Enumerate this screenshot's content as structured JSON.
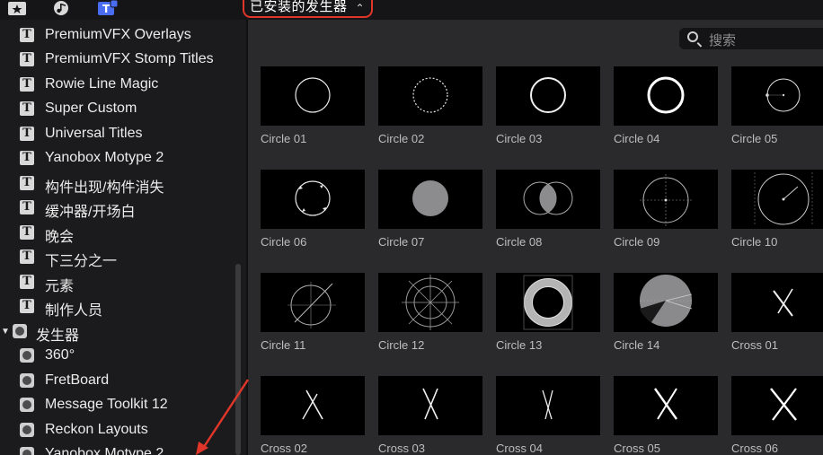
{
  "toolbar": {
    "icons": [
      "clapperboard-star-icon",
      "music-photo-icon",
      "titles-generators-icon"
    ],
    "dropdown_label": "已安装的发生器",
    "dropdown_chevron": "⌃⌄"
  },
  "search": {
    "placeholder": "搜索"
  },
  "sidebar": {
    "title_items": [
      "PremiumVFX Overlays",
      "PremiumVFX Stomp Titles",
      "Rowie Line Magic",
      "Super Custom",
      "Universal Titles",
      "Yanobox Motype 2",
      "构件出现/构件消失",
      "缓冲器/开场白",
      "晚会",
      "下三分之一",
      "元素",
      "制作人员"
    ],
    "group_label": "发生器",
    "generator_items": [
      "360°",
      "FretBoard",
      "Message Toolkit 12",
      "Reckon Layouts",
      "Yanobox Motype 2"
    ]
  },
  "grid": {
    "tiles": [
      "Circle 01",
      "Circle 02",
      "Circle 03",
      "Circle 04",
      "Circle 05",
      "Circle 06",
      "Circle 07",
      "Circle 08",
      "Circle 09",
      "Circle 10",
      "Circle 11",
      "Circle 12",
      "Circle 13",
      "Circle 14",
      "Cross 01",
      "Cross 02",
      "Cross 03",
      "Cross 04",
      "Cross 05",
      "Cross 06"
    ]
  },
  "colors": {
    "highlight_outline": "#e0362a",
    "annotation_arrow": "#e0362a",
    "icon_accent": "#4a6cf0"
  }
}
